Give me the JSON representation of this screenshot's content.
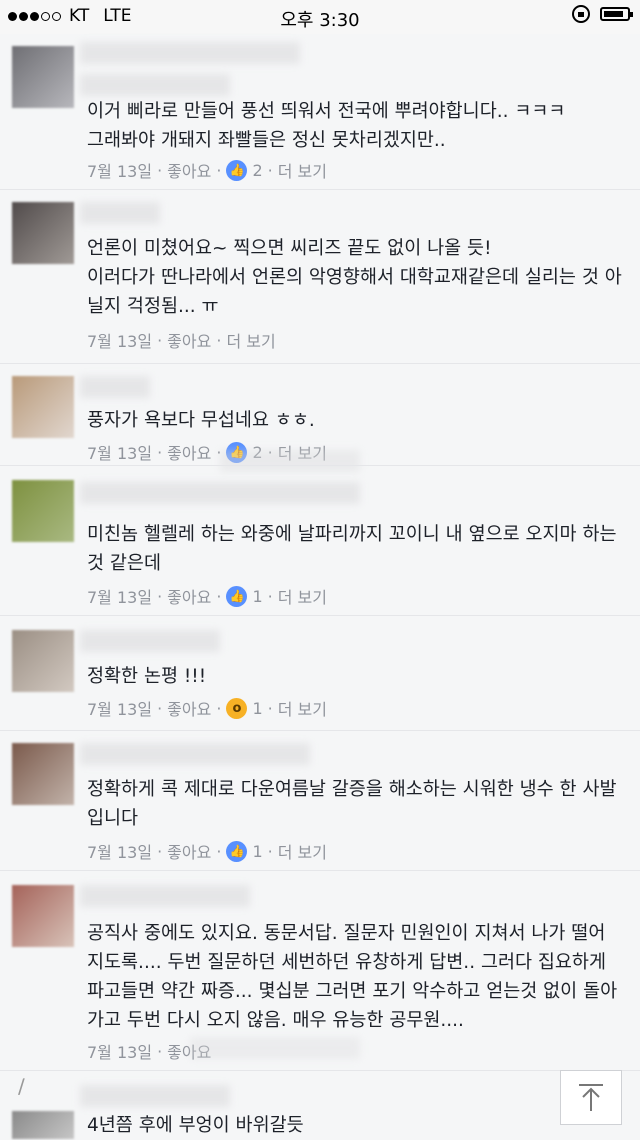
{
  "status_bar": {
    "carrier": "KT",
    "network": "LTE",
    "time": "오후 3:30",
    "signal_bars": 3,
    "signal_total": 5,
    "battery_level": 0.85
  },
  "comments": [
    {
      "text": "이거 삐라로 만들어 풍선 띄워서 전국에 뿌려야합니다.. ㅋㅋㅋ\n그래봐야 개돼지 좌빨들은 정신 못차리겠지만..",
      "date": "7월 13일",
      "like_label": "좋아요",
      "reaction": "like",
      "count": "2",
      "more": "더 보기"
    },
    {
      "text": "언론이 미쳤어요~ 찍으면 씨리즈 끝도 없이 나올 듯!\n이러다가 딴나라에서 언론의 악영향해서 대학교재같은데 실리는 것 아닐지 걱정됨... ㅠ",
      "date": "7월 13일",
      "like_label": "좋아요",
      "reaction": "",
      "count": "",
      "more": "더 보기"
    },
    {
      "text": "풍자가 욕보다 무섭네요 ㅎㅎ.",
      "date": "7월 13일",
      "like_label": "좋아요",
      "reaction": "like",
      "count": "2",
      "more": "더 보기"
    },
    {
      "text": "미친놈 헬렐레 하는 와중에 날파리까지 꼬이니 내 옆으로 오지마 하는 것 같은데",
      "date": "7월 13일",
      "like_label": "좋아요",
      "reaction": "like",
      "count": "1",
      "more": "더 보기"
    },
    {
      "text": "정확한 논평 !!!",
      "date": "7월 13일",
      "like_label": "좋아요",
      "reaction": "wow",
      "count": "1",
      "more": "더 보기"
    },
    {
      "text": "정확하게 콕 제대로 다운여름날 갈증을 해소하는 시워한 냉수 한 사발입니다",
      "date": "7월 13일",
      "like_label": "좋아요",
      "reaction": "like",
      "count": "1",
      "more": "더 보기"
    },
    {
      "text": "공직사 중에도 있지요. 동문서답. 질문자 민원인이 지쳐서 나가 떨어지도록.... 두번 질문하던 세번하던 유창하게 답변.. 그러다 집요하게 파고들면 약간 짜증... 몇십분 그러면 포기 악수하고 얻는것 없이 돌아가고 두번 다시 오지 않음. 매우 유능한 공무원....",
      "date": "7월 13일",
      "like_label": "좋아요",
      "reaction": "",
      "count": "",
      "more": ""
    },
    {
      "text": "4년쯤 후에 부엉이 바위갈듯",
      "date": "",
      "like_label": "",
      "reaction": "",
      "count": "",
      "more": ""
    }
  ]
}
